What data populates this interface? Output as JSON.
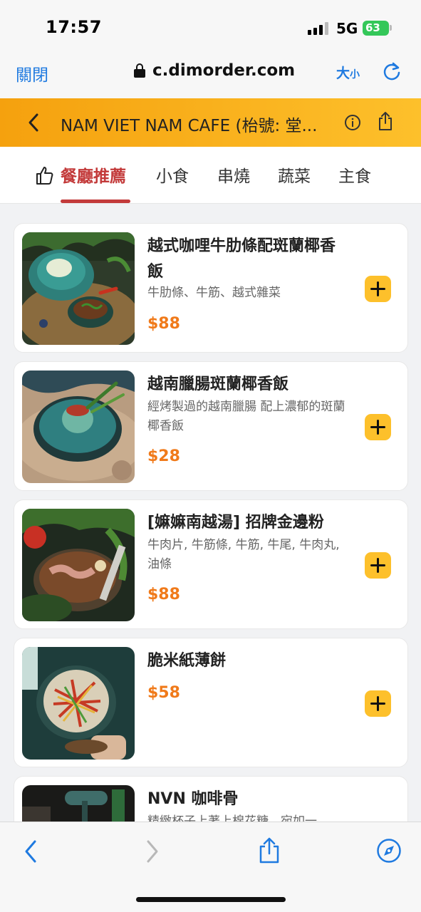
{
  "status_bar": {
    "time": "17:57",
    "network": "5G",
    "battery": "63"
  },
  "browser": {
    "close_label": "關閉",
    "url": "c.dimorder.com",
    "size_label_big": "大",
    "size_label_small": "小"
  },
  "header": {
    "title": "NAM VIET NAM CAFE (枱號: 堂..."
  },
  "categories": {
    "tabs": [
      {
        "label": "餐廳推薦",
        "active": true
      },
      {
        "label": "小食"
      },
      {
        "label": "串燒"
      },
      {
        "label": "蔬菜"
      },
      {
        "label": "主食"
      }
    ]
  },
  "menu": {
    "items": [
      {
        "name": "越式咖哩牛肋條配斑蘭椰香飯",
        "desc": "牛肋條、牛筋、越式雜菜",
        "price": "$88"
      },
      {
        "name": "越南臘腸斑蘭椰香飯",
        "desc": "經烤製過的越南臘腸 配上濃郁的斑蘭椰香飯",
        "price": "$28"
      },
      {
        "name": "[嫲嫲南越湯] 招牌金邊粉",
        "desc": "牛肉片, 牛筋條, 牛筋, 牛尾, 牛肉丸, 油條",
        "price": "$88"
      },
      {
        "name": "脆米紙薄餅",
        "desc": "",
        "price": "$58"
      },
      {
        "name": "NVN 咖啡骨",
        "desc": "精緻杯子上著上棉花糖，宛如一"
      }
    ]
  },
  "colors": {
    "accent": "#fdc02b",
    "price": "#f07a1a",
    "active_tab": "#c33a3a",
    "link": "#1f7ae0"
  },
  "icons": [
    "back-chevron-icon",
    "info-icon",
    "share-icon",
    "thumbs-up-icon",
    "add-icon",
    "lock-icon",
    "reload-icon",
    "compass-icon",
    "forward-chevron-icon"
  ]
}
